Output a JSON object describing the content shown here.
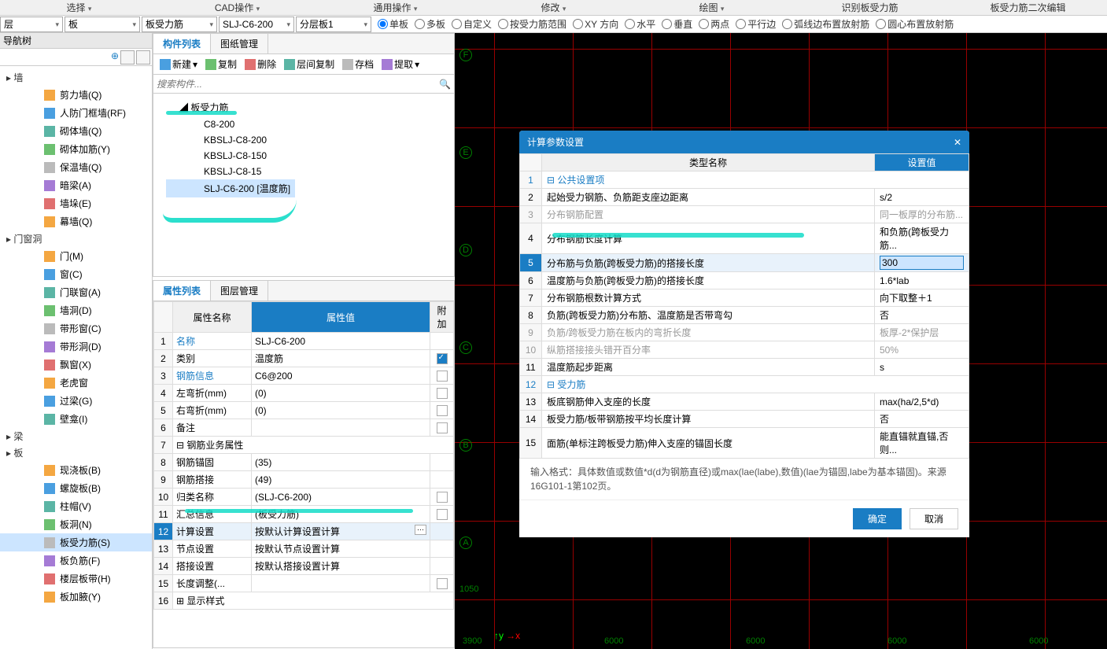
{
  "menubar": [
    "选择",
    "CAD操作",
    "通用操作",
    "修改",
    "绘图",
    "识别板受力筋",
    "板受力筋二次编辑"
  ],
  "dropdowns": {
    "d0": "层",
    "d1": "板",
    "d2": "板受力筋",
    "d3": "SLJ-C6-200",
    "d4": "分层板1"
  },
  "radios": [
    "单板",
    "多板",
    "自定义",
    "按受力筋范围",
    "XY 方向",
    "水平",
    "垂直",
    "两点",
    "平行边",
    "弧线边布置放射筋",
    "圆心布置放射筋"
  ],
  "radio_selected": 0,
  "nav": {
    "header": "导航树",
    "groups": [
      {
        "title": "墙",
        "items": [
          "剪力墙(Q)",
          "人防门框墙(RF)",
          "砌体墙(Q)",
          "砌体加筋(Y)",
          "保温墙(Q)",
          "暗梁(A)",
          "墙垛(E)",
          "幕墙(Q)"
        ]
      },
      {
        "title": "门窗洞",
        "items": [
          "门(M)",
          "窗(C)",
          "门联窗(A)",
          "墙洞(D)",
          "带形窗(C)",
          "带形洞(D)",
          "飘窗(X)",
          "老虎窗",
          "过梁(G)",
          "壁龛(I)"
        ]
      },
      {
        "title": "梁",
        "items": []
      },
      {
        "title": "板",
        "items": [
          "现浇板(B)",
          "螺旋板(B)",
          "柱帽(V)",
          "板洞(N)",
          "板受力筋(S)",
          "板负筋(F)",
          "楼层板带(H)",
          "板加腋(Y)"
        ]
      }
    ],
    "selected": "板受力筋(S)"
  },
  "complist": {
    "tabs": [
      "构件列表",
      "图纸管理"
    ],
    "toolbar": {
      "new": "新建",
      "copy": "复制",
      "del": "删除",
      "layercopy": "层间复制",
      "archive": "存档",
      "extract": "提取"
    },
    "search_placeholder": "搜索构件...",
    "root": "板受力筋",
    "items": [
      "C8-200",
      "KBSLJ-C8-200",
      "KBSLJ-C8-150",
      "KBSLJ-C8-15",
      "SLJ-C6-200 [温度筋]"
    ],
    "selected": "SLJ-C6-200 [温度筋]"
  },
  "proplist": {
    "tabs": [
      "属性列表",
      "图层管理"
    ],
    "cols": {
      "name": "属性名称",
      "value": "属性值",
      "add": "附加"
    },
    "rows": [
      {
        "n": "名称",
        "v": "SLJ-C6-200",
        "link": true,
        "chk": null
      },
      {
        "n": "类别",
        "v": "温度筋",
        "chk": true
      },
      {
        "n": "钢筋信息",
        "v": "C6@200",
        "link": true,
        "chk": false
      },
      {
        "n": "左弯折(mm)",
        "v": "(0)",
        "chk": false
      },
      {
        "n": "右弯折(mm)",
        "v": "(0)",
        "chk": false
      },
      {
        "n": "备注",
        "v": "",
        "chk": false
      },
      {
        "n": "钢筋业务属性",
        "grp": true
      },
      {
        "n": "钢筋锚固",
        "v": "(35)",
        "indent": 1
      },
      {
        "n": "钢筋搭接",
        "v": "(49)",
        "indent": 1
      },
      {
        "n": "归类名称",
        "v": "(SLJ-C6-200)",
        "indent": 1,
        "chk": false
      },
      {
        "n": "汇总信息",
        "v": "(板受力筋)",
        "indent": 1,
        "chk": false
      },
      {
        "n": "计算设置",
        "v": "按默认计算设置计算",
        "indent": 1,
        "sel": true,
        "btn": true
      },
      {
        "n": "节点设置",
        "v": "按默认节点设置计算",
        "indent": 1
      },
      {
        "n": "搭接设置",
        "v": "按默认搭接设置计算",
        "indent": 1
      },
      {
        "n": "长度调整(...",
        "v": "",
        "indent": 1,
        "chk": false
      },
      {
        "n": "显示样式",
        "grp": true,
        "plus": true
      }
    ]
  },
  "dialog": {
    "title": "计算参数设置",
    "cols": {
      "type": "类型名称",
      "setval": "设置值"
    },
    "rows": [
      {
        "i": 1,
        "n": "公共设置项",
        "grp": true
      },
      {
        "i": 2,
        "n": "起始受力钢筋、负筋距支座边距离",
        "v": "s/2"
      },
      {
        "i": 3,
        "n": "分布钢筋配置",
        "v": "同一板厚的分布筋...",
        "grey": true
      },
      {
        "i": 4,
        "n": "分布钢筋长度计算",
        "v": "和负筋(跨板受力筋..."
      },
      {
        "i": 5,
        "n": "分布筋与负筋(跨板受力筋)的搭接长度",
        "v": "300",
        "sel": true,
        "input": true
      },
      {
        "i": 6,
        "n": "温度筋与负筋(跨板受力筋)的搭接长度",
        "v": "1.6*lab"
      },
      {
        "i": 7,
        "n": "分布钢筋根数计算方式",
        "v": "向下取整＋1"
      },
      {
        "i": 8,
        "n": "负筋(跨板受力筋)分布筋、温度筋是否带弯勾",
        "v": "否"
      },
      {
        "i": 9,
        "n": "负筋/跨板受力筋在板内的弯折长度",
        "v": "板厚-2*保护层",
        "grey": true
      },
      {
        "i": 10,
        "n": "纵筋搭接接头错开百分率",
        "v": "50%",
        "grey": true
      },
      {
        "i": 11,
        "n": "温度筋起步距离",
        "v": "s"
      },
      {
        "i": 12,
        "n": "受力筋",
        "grp": true
      },
      {
        "i": 13,
        "n": "板底钢筋伸入支座的长度",
        "v": "max(ha/2,5*d)"
      },
      {
        "i": 14,
        "n": "板受力筋/板带钢筋按平均长度计算",
        "v": "否"
      },
      {
        "i": 15,
        "n": "面筋(单标注跨板受力筋)伸入支座的锚固长度",
        "v": "能直锚就直锚,否则..."
      }
    ],
    "hint": "输入格式：具体数值或数值*d(d为钢筋直径)或max(lae(labe),数值)(lae为锚固,labe为基本锚固)。来源16G101-1第102页。",
    "ok": "确定",
    "cancel": "取消"
  },
  "canvas": {
    "axis_h": [
      "F",
      "E",
      "D",
      "C",
      "B",
      "A"
    ],
    "dim_bottom": [
      "3900",
      "6000",
      "6000",
      "6000",
      "6000"
    ],
    "dim_left": "1050",
    "x": "x",
    "y": "y"
  }
}
